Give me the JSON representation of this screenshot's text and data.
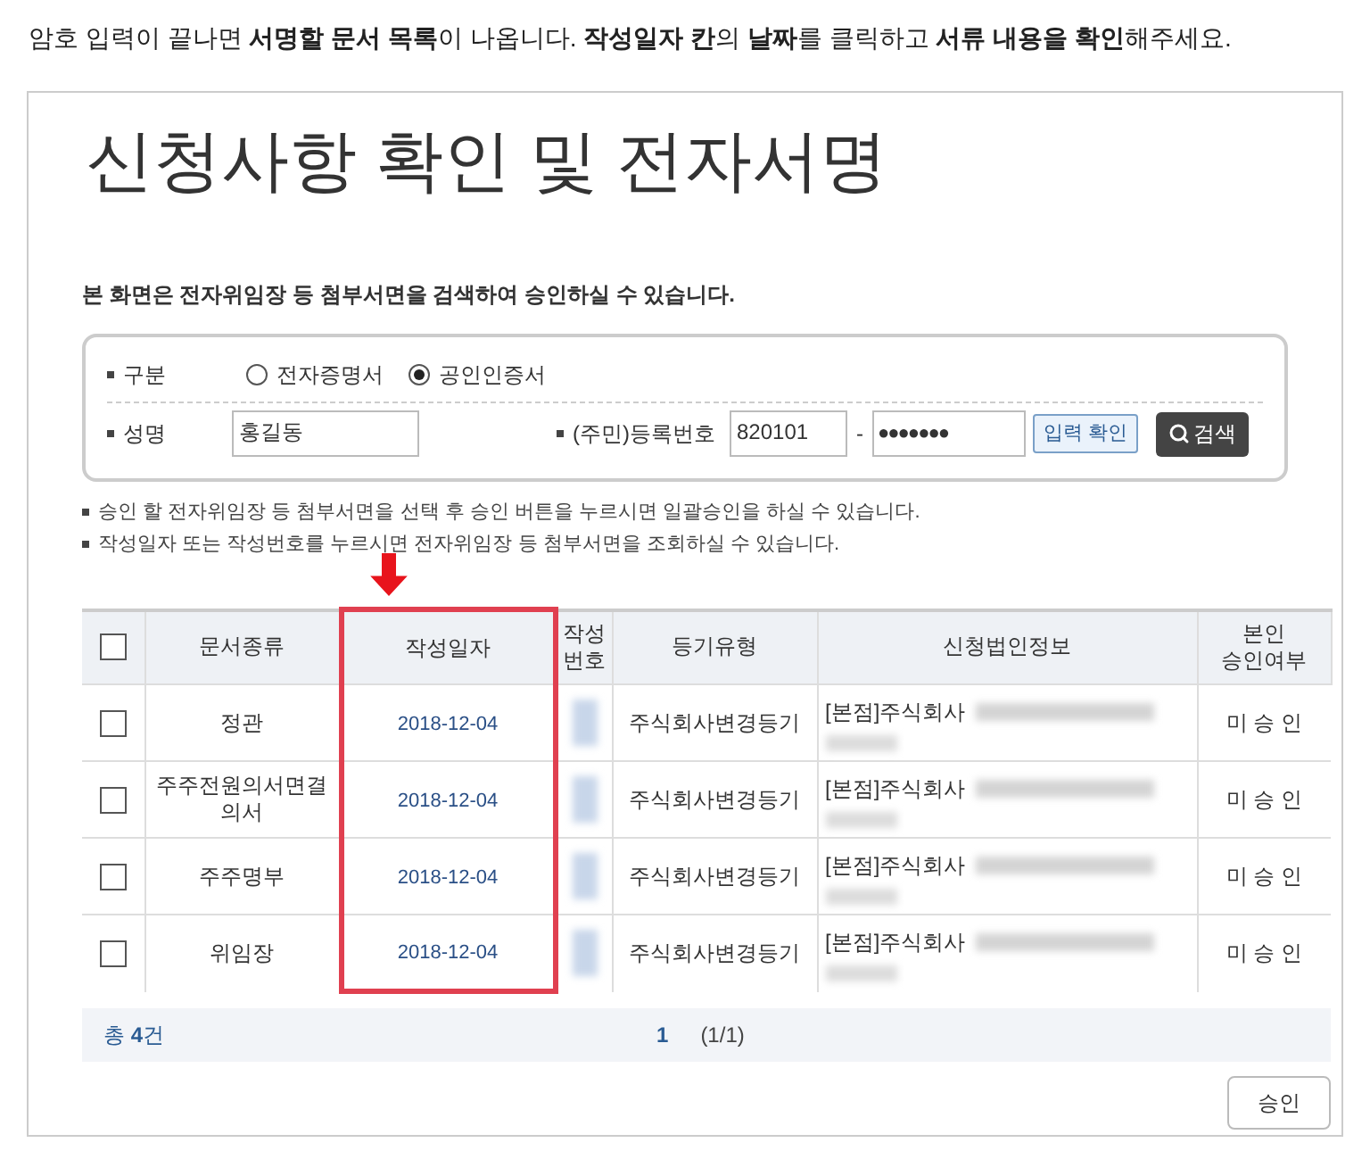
{
  "intro": "암호 입력이 끝나면 **서명할 문서 목록**이 나옵니다. **작성일자 칸**의 **날짜**를 클릭하고 **서류 내용을 확인**해주세요.",
  "title": "신청사항 확인 및 전자서명",
  "subtitle": "본 화면은 전자위임장 등 첨부서면을 검색하여 승인하실 수 있습니다.",
  "search": {
    "type_label": "구분",
    "options": [
      {
        "label": "전자증명서",
        "selected": false
      },
      {
        "label": "공인인증서",
        "selected": true
      }
    ],
    "name_label": "성명",
    "name_value": "홍길동",
    "id_label": "(주민)등록번호",
    "id_front": "820101",
    "id_separator": "-",
    "id_back": "●●●●●●●",
    "confirm_button": "입력 확인",
    "search_button": "검색"
  },
  "notes": [
    "승인 할 전자위임장 등 첨부서면을 선택 후 승인 버튼을 누르시면 일괄승인을 하실 수 있습니다.",
    "작성일자 또는 작성번호를 누르시면 전자위임장 등 첨부서면을 조회하실 수 있습니다."
  ],
  "table": {
    "header_checked": false,
    "columns": [
      {
        "label": "문서종류",
        "highlighted": false
      },
      {
        "label": "작성일자",
        "highlighted": true
      },
      {
        "label": "작성\n번호",
        "highlighted": false
      },
      {
        "label": "등기유형",
        "highlighted": false
      },
      {
        "label": "신청법인정보",
        "highlighted": false
      },
      {
        "label": "본인\n승인여부",
        "highlighted": false
      }
    ],
    "rows": [
      {
        "checked": false,
        "doc_type": "정관",
        "date": "2018-12-04",
        "reg_type": "주식회사변경등기",
        "corp": "[본점]주식회사",
        "status": "미 승 인"
      },
      {
        "checked": false,
        "doc_type": "주주전원의서면결의서",
        "date": "2018-12-04",
        "reg_type": "주식회사변경등기",
        "corp": "[본점]주식회사",
        "status": "미 승 인"
      },
      {
        "checked": false,
        "doc_type": "주주명부",
        "date": "2018-12-04",
        "reg_type": "주식회사변경등기",
        "corp": "[본점]주식회사",
        "status": "미 승 인"
      },
      {
        "checked": false,
        "doc_type": "위임장",
        "date": "2018-12-04",
        "reg_type": "주식회사변경등기",
        "corp": "[본점]주식회사",
        "status": "미 승 인"
      }
    ]
  },
  "footer": {
    "total": "총 **4**건",
    "page": "1",
    "page_info": "(1/1)"
  },
  "approve_button": "승인"
}
